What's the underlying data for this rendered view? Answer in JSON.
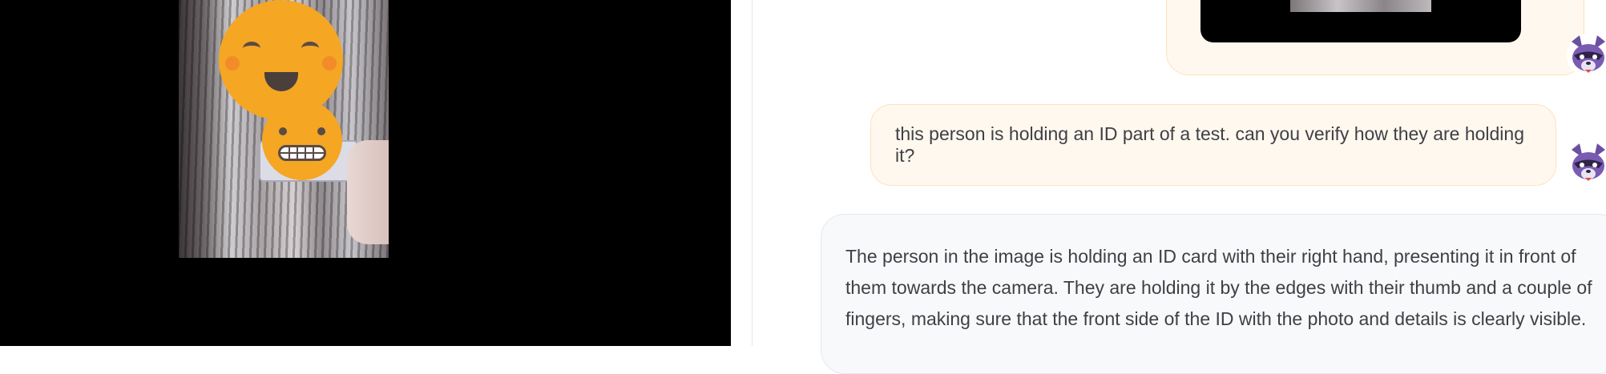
{
  "media": {
    "description_icons": [
      "smiling-face-icon",
      "grimacing-face-icon"
    ]
  },
  "chat": {
    "messages": [
      {
        "role": "user",
        "text": "this person is holding an ID part of a test. can you verify how they are holding it?"
      },
      {
        "role": "assistant",
        "lines": [
          "The person in the image is holding an ID card with their right hand, presenting it in front of",
          "them towards the camera. They are holding it by the edges with their thumb and a couple of",
          "fingers, making sure that the front side of the ID with the photo and details is clearly visible."
        ]
      }
    ],
    "avatar_icon": "raccoon-avatar-icon"
  },
  "colors": {
    "user_bubble_bg": "#fff8ee",
    "user_bubble_border": "#fde3bf",
    "bot_bubble_bg": "#f8f9fb",
    "emoji_yellow": "#f5a623"
  }
}
